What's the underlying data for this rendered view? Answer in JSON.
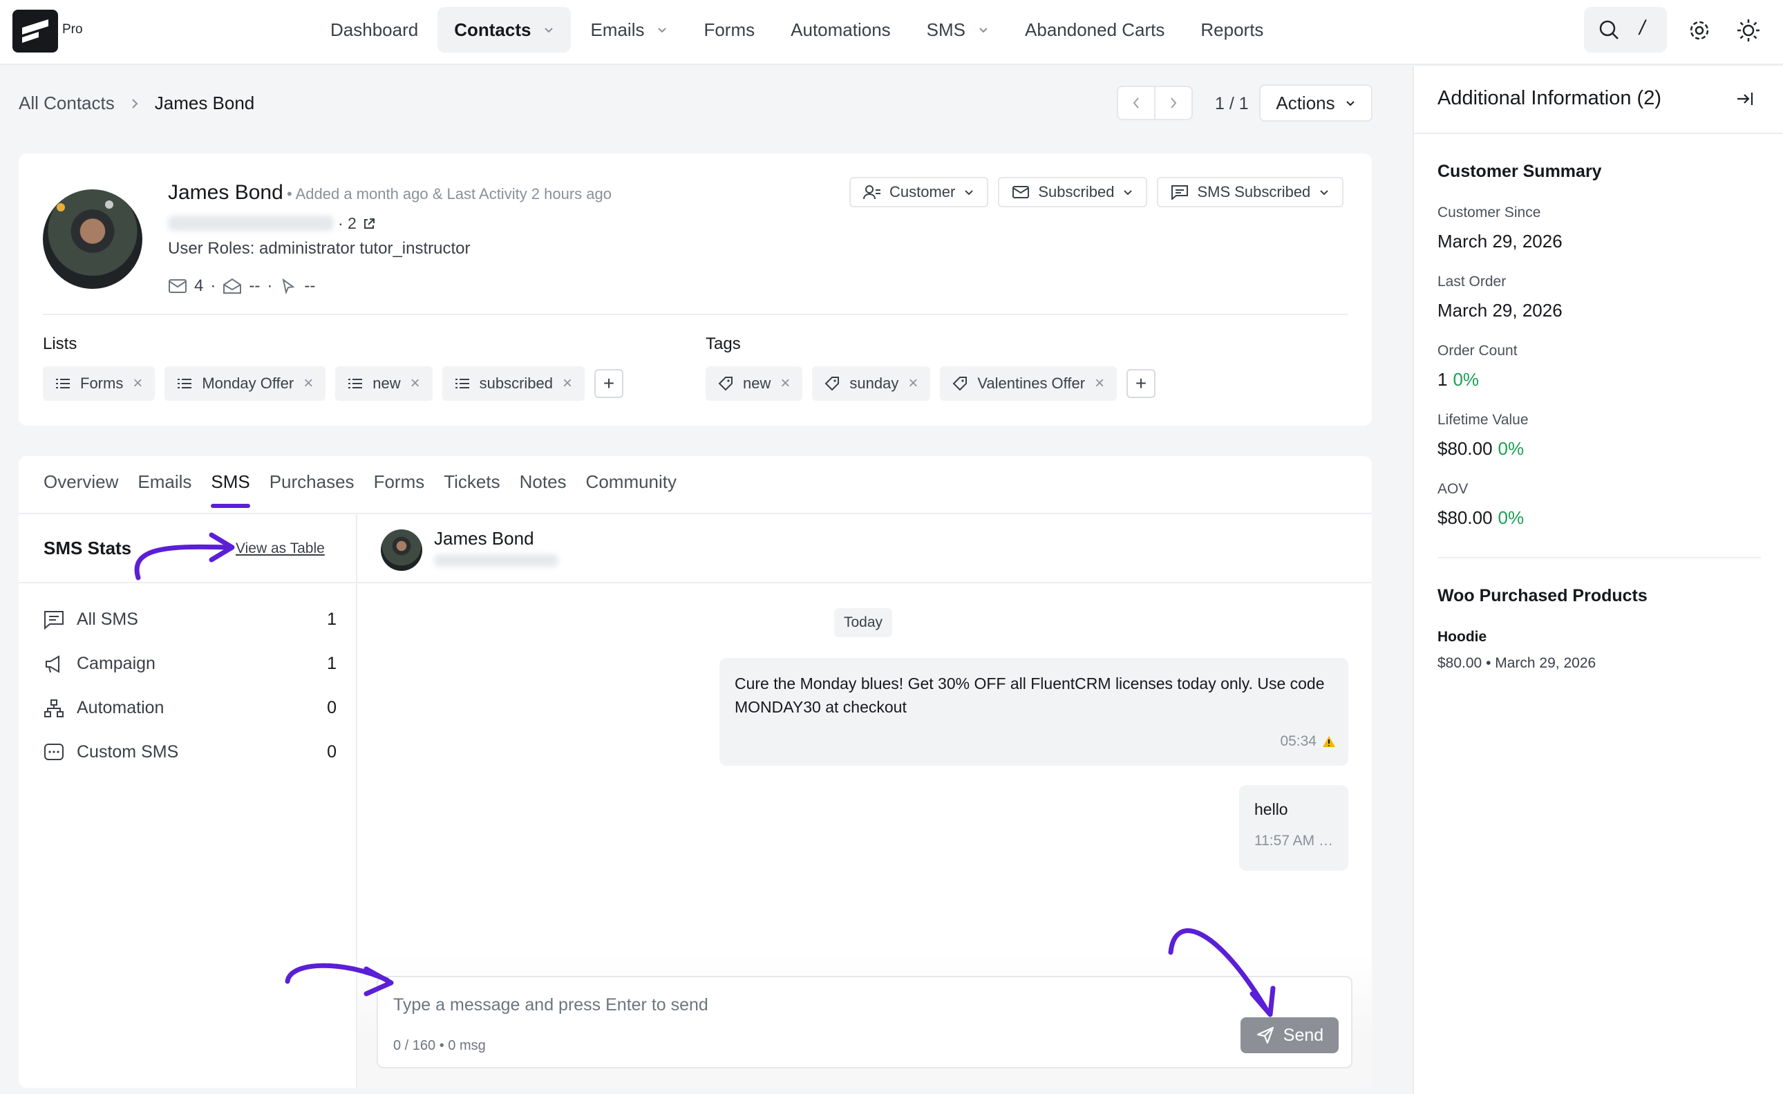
{
  "logo": {
    "badge": "Pro"
  },
  "nav": {
    "items": [
      {
        "label": "Dashboard",
        "dropdown": false
      },
      {
        "label": "Contacts",
        "dropdown": true,
        "active": true
      },
      {
        "label": "Emails",
        "dropdown": true
      },
      {
        "label": "Forms",
        "dropdown": false
      },
      {
        "label": "Automations",
        "dropdown": false
      },
      {
        "label": "SMS",
        "dropdown": true
      },
      {
        "label": "Abandoned Carts",
        "dropdown": false
      },
      {
        "label": "Reports",
        "dropdown": false
      }
    ],
    "search_shortcut": "/"
  },
  "breadcrumb": {
    "root": "All Contacts",
    "current": "James Bond"
  },
  "pager": {
    "count": "1 / 1",
    "actions_label": "Actions"
  },
  "profile": {
    "name": "James Bond",
    "meta": "• Added a month ago & Last Activity 2 hours ago",
    "hidden_count": "· 2",
    "roles": "User Roles: administrator  tutor_instructor",
    "stats": {
      "sent": "4",
      "opened": "--",
      "clicked": "--"
    },
    "status_buttons": {
      "type": "Customer",
      "email": "Subscribed",
      "sms": "SMS Subscribed"
    },
    "lists_label": "Lists",
    "lists": [
      "Forms",
      "Monday Offer",
      "new",
      "subscribed"
    ],
    "tags_label": "Tags",
    "tags": [
      "new",
      "sunday",
      "Valentines Offer"
    ]
  },
  "tabs": [
    "Overview",
    "Emails",
    "SMS",
    "Purchases",
    "Forms",
    "Tickets",
    "Notes",
    "Community"
  ],
  "sms": {
    "stats_title": "SMS Stats",
    "view_table": "View as Table",
    "stats": [
      {
        "label": "All SMS",
        "value": "1",
        "icon": "chat-icon"
      },
      {
        "label": "Campaign",
        "value": "1",
        "icon": "megaphone-icon"
      },
      {
        "label": "Automation",
        "value": "0",
        "icon": "flow-icon"
      },
      {
        "label": "Custom SMS",
        "value": "0",
        "icon": "message-dots-icon"
      }
    ],
    "chat_name": "James Bond",
    "day_label": "Today",
    "messages": [
      {
        "text": "Cure the Monday blues! Get 30% OFF all FluentCRM licenses today only. Use code MONDAY30 at checkout",
        "time": "05:34",
        "status": "warning-icon"
      },
      {
        "text": "hello",
        "time": "11:57 AM …"
      }
    ],
    "compose_placeholder": "Type a message and press Enter to send",
    "counter": "0 / 160 • 0 msg",
    "send_label": "Send"
  },
  "panel": {
    "title": "Additional Information (2)",
    "summary_title": "Customer Summary",
    "fields": [
      {
        "key": "Customer Since",
        "value": "March 29, 2026",
        "change": ""
      },
      {
        "key": "Last Order",
        "value": "March 29, 2026",
        "change": ""
      },
      {
        "key": "Order Count",
        "value": "1",
        "change": "0%"
      },
      {
        "key": "Lifetime Value",
        "value": "$80.00",
        "change": "0%"
      },
      {
        "key": "AOV",
        "value": "$80.00",
        "change": "0%"
      }
    ],
    "products_title": "Woo Purchased Products",
    "product": {
      "name": "Hoodie",
      "meta": "$80.00 • March 29, 2026"
    }
  },
  "colors": {
    "accent": "#5a1fd6",
    "positive": "#1aa053",
    "send_button": "#8c9096"
  }
}
